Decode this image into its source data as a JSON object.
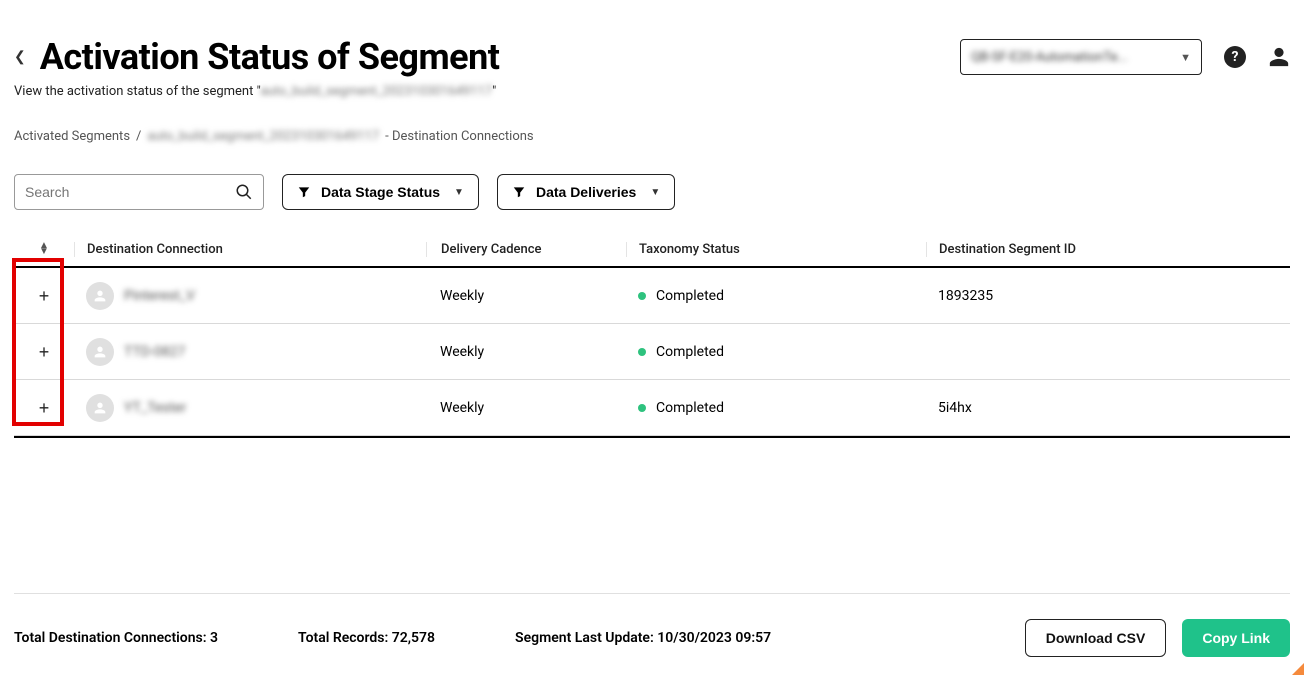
{
  "header": {
    "title": "Activation Status of Segment",
    "subtitle_prefix": "View the activation status of the segment \"",
    "subtitle_segment": "auto_build_segment_202310301649117",
    "subtitle_suffix": "\"",
    "org_selector": "QB-SF-E20-AutomationTe..."
  },
  "breadcrumb": {
    "root": "Activated Segments",
    "sep": "/",
    "segment": "auto_build_segment_202310301649117",
    "tail": "- Destination Connections"
  },
  "controls": {
    "search_placeholder": "Search",
    "filter_stage": "Data Stage Status",
    "filter_deliveries": "Data Deliveries"
  },
  "table": {
    "headers": {
      "destination": "Destination Connection",
      "cadence": "Delivery Cadence",
      "taxonomy": "Taxonomy Status",
      "segment_id": "Destination Segment ID"
    },
    "rows": [
      {
        "destination": "Pinterest_V",
        "cadence": "Weekly",
        "taxonomy": "Completed",
        "segment_id": "1893235"
      },
      {
        "destination": "TTD-0827",
        "cadence": "Weekly",
        "taxonomy": "Completed",
        "segment_id": ""
      },
      {
        "destination": "YT_Tester",
        "cadence": "Weekly",
        "taxonomy": "Completed",
        "segment_id": "5i4hx"
      }
    ]
  },
  "footer": {
    "total_conn": "Total Destination Connections: 3",
    "total_records": "Total Records: 72,578",
    "last_update": "Segment Last Update: 10/30/2023 09:57",
    "download": "Download CSV",
    "copy": "Copy Link"
  },
  "status_color": "#2ec27e",
  "accent_color": "#1fc28a"
}
